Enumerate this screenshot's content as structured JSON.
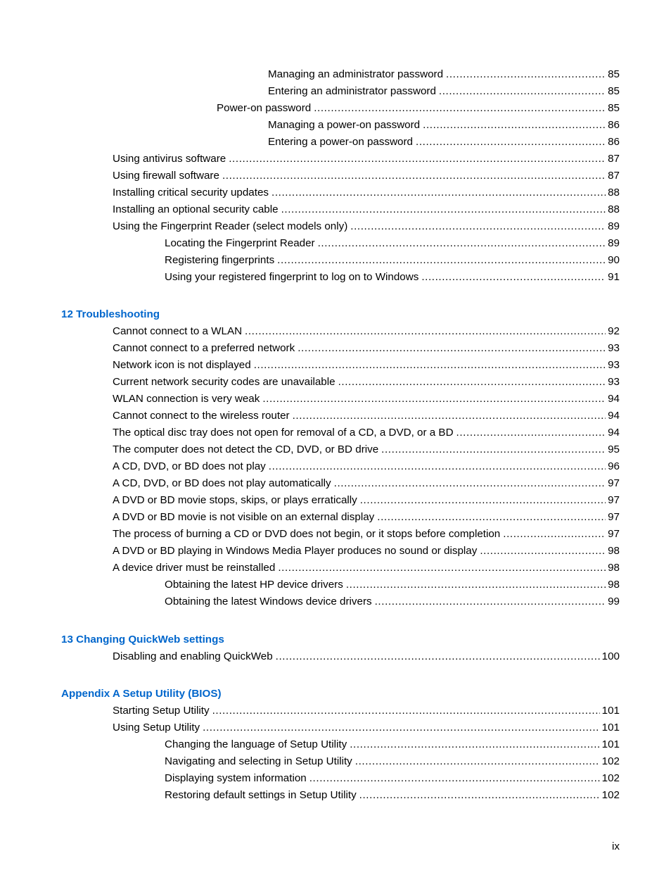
{
  "accent_color": "#0066cc",
  "entries_top": [
    {
      "title": "Managing an administrator password",
      "page": "85",
      "level": 4
    },
    {
      "title": "Entering an administrator password",
      "page": "85",
      "level": 4
    },
    {
      "title": "Power-on password",
      "page": "85",
      "level": 3
    },
    {
      "title": "Managing a power-on password",
      "page": "86",
      "level": 4
    },
    {
      "title": "Entering a power-on password",
      "page": "86",
      "level": 4
    },
    {
      "title": "Using antivirus software",
      "page": "87",
      "level": 1
    },
    {
      "title": "Using firewall software",
      "page": "87",
      "level": 1
    },
    {
      "title": "Installing critical security updates",
      "page": "88",
      "level": 1
    },
    {
      "title": "Installing an optional security cable",
      "page": "88",
      "level": 1
    },
    {
      "title": "Using the Fingerprint Reader (select models only)",
      "page": "89",
      "level": 1
    },
    {
      "title": "Locating the Fingerprint Reader",
      "page": "89",
      "level": 2
    },
    {
      "title": "Registering fingerprints",
      "page": "90",
      "level": 2
    },
    {
      "title": "Using your registered fingerprint to log on to Windows",
      "page": "91",
      "level": 2
    }
  ],
  "chapters": [
    {
      "heading": "12  Troubleshooting",
      "entries": [
        {
          "title": "Cannot connect to a WLAN",
          "page": "92",
          "level": 1
        },
        {
          "title": "Cannot connect to a preferred network",
          "page": "93",
          "level": 1
        },
        {
          "title": "Network icon is not displayed",
          "page": "93",
          "level": 1
        },
        {
          "title": "Current network security codes are unavailable",
          "page": "93",
          "level": 1
        },
        {
          "title": "WLAN connection is very weak",
          "page": "94",
          "level": 1
        },
        {
          "title": "Cannot connect to the wireless router",
          "page": "94",
          "level": 1
        },
        {
          "title": "The optical disc tray does not open for removal of a CD, a DVD, or a BD",
          "page": "94",
          "level": 1
        },
        {
          "title": "The computer does not detect the CD, DVD, or BD drive",
          "page": "95",
          "level": 1
        },
        {
          "title": "A CD, DVD, or BD does not play",
          "page": "96",
          "level": 1
        },
        {
          "title": "A CD, DVD, or BD does not play automatically",
          "page": "97",
          "level": 1
        },
        {
          "title": "A DVD or BD movie stops, skips, or plays erratically",
          "page": "97",
          "level": 1
        },
        {
          "title": "A DVD or BD movie is not visible on an external display",
          "page": "97",
          "level": 1
        },
        {
          "title": "The process of burning a CD or DVD does not begin, or it stops before completion",
          "page": "97",
          "level": 1
        },
        {
          "title": "A DVD or BD playing in Windows Media Player produces no sound or display",
          "page": "98",
          "level": 1
        },
        {
          "title": "A device driver must be reinstalled",
          "page": "98",
          "level": 1
        },
        {
          "title": "Obtaining the latest HP device drivers",
          "page": "98",
          "level": 2
        },
        {
          "title": "Obtaining the latest Windows device drivers",
          "page": "99",
          "level": 2
        }
      ]
    },
    {
      "heading": "13  Changing QuickWeb settings",
      "entries": [
        {
          "title": "Disabling and enabling QuickWeb",
          "page": "100",
          "level": 1
        }
      ]
    },
    {
      "heading": "Appendix A  Setup Utility (BIOS)",
      "entries": [
        {
          "title": "Starting Setup Utility",
          "page": "101",
          "level": 1
        },
        {
          "title": "Using Setup Utility",
          "page": "101",
          "level": 1
        },
        {
          "title": "Changing the language of Setup Utility",
          "page": "101",
          "level": 2
        },
        {
          "title": "Navigating and selecting in Setup Utility",
          "page": "102",
          "level": 2
        },
        {
          "title": "Displaying system information",
          "page": "102",
          "level": 2
        },
        {
          "title": "Restoring default settings in Setup Utility",
          "page": "102",
          "level": 2
        }
      ]
    }
  ],
  "footer": {
    "page_number": "ix"
  }
}
